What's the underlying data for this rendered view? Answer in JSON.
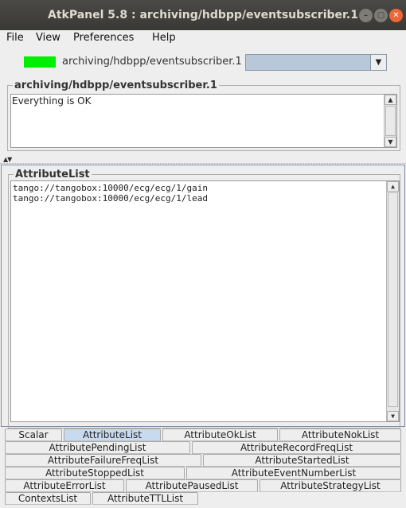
{
  "window": {
    "title": "AtkPanel 5.8 : archiving/hdbpp/eventsubscriber.1",
    "minimize_glyph": "–",
    "maximize_glyph": "▢",
    "close_glyph": "✕"
  },
  "menubar": {
    "items": [
      "File",
      "View",
      "Preferences",
      "Help"
    ]
  },
  "device": {
    "state_color": "#00ee00",
    "name": "archiving/hdbpp/eventsubscriber.1",
    "selector_value": "",
    "selector_arrow": "▼"
  },
  "status": {
    "group_title": "archiving/hdbpp/eventsubscriber.1",
    "text": "Everything is OK"
  },
  "splitter": {
    "marks": "▲▼"
  },
  "attribute_list": {
    "group_title": "AttributeList",
    "lines": [
      "tango://tangobox:10000/ecg/ecg/1/gain",
      "tango://tangobox:10000/ecg/ecg/1/lead"
    ]
  },
  "scroll": {
    "up": "▲",
    "down": "▼"
  },
  "tabs": {
    "active": "AttributeList",
    "labels": [
      "Scalar",
      "AttributeList",
      "AttributeOkList",
      "AttributeNokList",
      "AttributePendingList",
      "AttributeRecordFreqList",
      "AttributeFailureFreqList",
      "AttributeStartedList",
      "AttributeStoppedList",
      "AttributeEventNumberList",
      "AttributeErrorList",
      "AttributePausedList",
      "AttributeStrategyList",
      "ContextsList",
      "AttributeTTLList"
    ]
  }
}
